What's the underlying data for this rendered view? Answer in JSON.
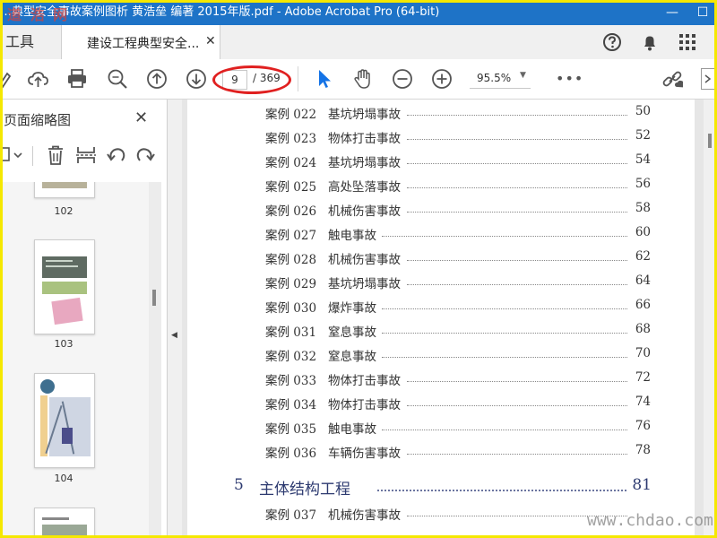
{
  "window": {
    "title": "…典型安全事故案例图析 黄浩垒 编著 2015年版.pdf - Adobe Acrobat Pro (64-bit)",
    "minimize_glyph": "—",
    "maximize_glyph": "☐"
  },
  "watermarks": {
    "top": "道 浩 网",
    "bottom": "www.chdao.com"
  },
  "tabs": {
    "tools": "工具",
    "document": "建设工程典型安全...",
    "close_glyph": "✕"
  },
  "toolbar": {
    "current_page": "9",
    "total_pages": "/ 369",
    "zoom": "95.5%",
    "zoom_caret": "▼",
    "more": "•••"
  },
  "sidepanel": {
    "title": "页面缩略图",
    "close_glyph": "✕",
    "thumbnails": [
      {
        "label": "102"
      },
      {
        "label": "103"
      },
      {
        "label": "104"
      },
      {
        "label": ""
      }
    ]
  },
  "toc": {
    "entries": [
      {
        "num": "案例 022",
        "title": "基坑坍塌事故",
        "page": "50"
      },
      {
        "num": "案例 023",
        "title": "物体打击事故",
        "page": "52"
      },
      {
        "num": "案例 024",
        "title": "基坑坍塌事故",
        "page": "54"
      },
      {
        "num": "案例 025",
        "title": "高处坠落事故",
        "page": "56"
      },
      {
        "num": "案例 026",
        "title": "机械伤害事故",
        "page": "58"
      },
      {
        "num": "案例 027",
        "title": "触电事故",
        "page": "60"
      },
      {
        "num": "案例 028",
        "title": "机械伤害事故",
        "page": "62"
      },
      {
        "num": "案例 029",
        "title": "基坑坍塌事故",
        "page": "64"
      },
      {
        "num": "案例 030",
        "title": "爆炸事故",
        "page": "66"
      },
      {
        "num": "案例 031",
        "title": "窒息事故",
        "page": "68"
      },
      {
        "num": "案例 032",
        "title": "窒息事故",
        "page": "70"
      },
      {
        "num": "案例 033",
        "title": "物体打击事故",
        "page": "72"
      },
      {
        "num": "案例 034",
        "title": "物体打击事故",
        "page": "74"
      },
      {
        "num": "案例 035",
        "title": "触电事故",
        "page": "76"
      },
      {
        "num": "案例 036",
        "title": "车辆伤害事故",
        "page": "78"
      }
    ],
    "chapter": {
      "num": "5",
      "title": "主体结构工程",
      "page": "81"
    },
    "after_chapter": [
      {
        "num": "案例 037",
        "title": "机械伤害事故",
        "page": ""
      }
    ]
  },
  "colors": {
    "titlebar": "#1e73c7",
    "select_tool": "#1473e6",
    "highlight": "#e02020",
    "chapter_text": "#2d3a70",
    "border_frame": "#f5e800"
  }
}
